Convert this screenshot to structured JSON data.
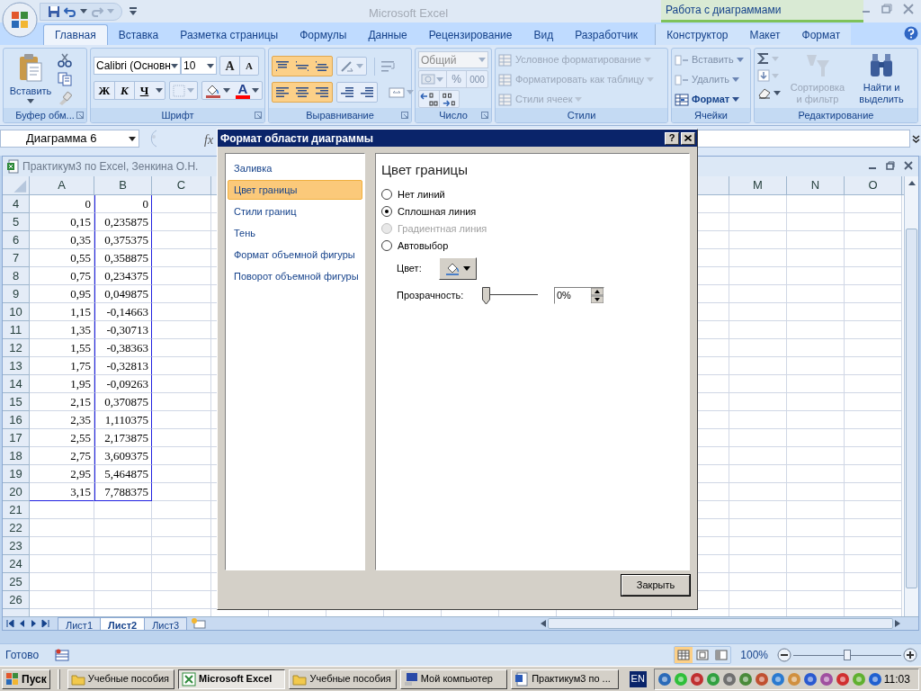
{
  "title_bar": {
    "app_title": "Microsoft Excel",
    "context_group": "Работа с диаграммами"
  },
  "ribbon_tabs": [
    {
      "label": "Главная",
      "selected": true,
      "kind": "tab"
    },
    {
      "label": "Вставка",
      "selected": false,
      "kind": "tab"
    },
    {
      "label": "Разметка страницы",
      "selected": false,
      "kind": "tab"
    },
    {
      "label": "Формулы",
      "selected": false,
      "kind": "tab"
    },
    {
      "label": "Данные",
      "selected": false,
      "kind": "tab"
    },
    {
      "label": "Рецензирование",
      "selected": false,
      "kind": "tab"
    },
    {
      "label": "Вид",
      "selected": false,
      "kind": "tab"
    },
    {
      "label": "Разработчик",
      "selected": false,
      "kind": "tab"
    },
    {
      "label": "Конструктор",
      "selected": false,
      "kind": "context"
    },
    {
      "label": "Макет",
      "selected": false,
      "kind": "context"
    },
    {
      "label": "Формат",
      "selected": false,
      "kind": "context"
    }
  ],
  "ribbon": {
    "clipboard": {
      "label": "Буфер обм...",
      "paste": "Вставить"
    },
    "font": {
      "label": "Шрифт",
      "font_name": "Calibri (Основн",
      "font_size": "10",
      "grow": "A",
      "shrink": "A",
      "bold": "Ж",
      "italic": "К",
      "underline": "Ч",
      "font_color": "A"
    },
    "alignment": {
      "label": "Выравнивание"
    },
    "number": {
      "label": "Число",
      "format": "Общий",
      "percent": "%",
      "thousands": "000"
    },
    "styles": {
      "label": "Стили",
      "items": [
        {
          "label": "Условное форматирование",
          "disabled": true
        },
        {
          "label": "Форматировать как таблицу",
          "disabled": true
        },
        {
          "label": "Стили ячеек",
          "disabled": true
        }
      ]
    },
    "cells": {
      "label": "Ячейки",
      "items": [
        {
          "label": "Вставить",
          "disabled": true
        },
        {
          "label": "Удалить",
          "disabled": true
        },
        {
          "label": "Формат",
          "disabled": false
        }
      ]
    },
    "editing": {
      "label": "Редактирование",
      "sort": {
        "lines": [
          "Сортировка",
          "и фильтр"
        ],
        "disabled": true
      },
      "find": {
        "lines": [
          "Найти и",
          "выделить"
        ],
        "disabled": false
      }
    }
  },
  "formula_bar": {
    "name_box": "Диаграмма 6",
    "function_label": "fx"
  },
  "workbook": {
    "title": "Практикум3 по Excel, Зенкина О.Н."
  },
  "sheet": {
    "columns": [
      "A",
      "B",
      "C",
      "M",
      "N",
      "O"
    ],
    "rows": [
      {
        "number": "4",
        "a": "0",
        "b": "0"
      },
      {
        "number": "5",
        "a": "0,15",
        "b": "0,235875"
      },
      {
        "number": "6",
        "a": "0,35",
        "b": "0,375375"
      },
      {
        "number": "7",
        "a": "0,55",
        "b": "0,358875"
      },
      {
        "number": "8",
        "a": "0,75",
        "b": "0,234375"
      },
      {
        "number": "9",
        "a": "0,95",
        "b": "0,049875"
      },
      {
        "number": "10",
        "a": "1,15",
        "b": "-0,14663"
      },
      {
        "number": "11",
        "a": "1,35",
        "b": "-0,30713"
      },
      {
        "number": "12",
        "a": "1,55",
        "b": "-0,38363"
      },
      {
        "number": "13",
        "a": "1,75",
        "b": "-0,32813"
      },
      {
        "number": "14",
        "a": "1,95",
        "b": "-0,09263"
      },
      {
        "number": "15",
        "a": "2,15",
        "b": "0,370875"
      },
      {
        "number": "16",
        "a": "2,35",
        "b": "1,110375"
      },
      {
        "number": "17",
        "a": "2,55",
        "b": "2,173875"
      },
      {
        "number": "18",
        "a": "2,75",
        "b": "3,609375"
      },
      {
        "number": "19",
        "a": "2,95",
        "b": "5,464875"
      },
      {
        "number": "20",
        "a": "3,15",
        "b": "7,788375"
      },
      {
        "number": "21"
      },
      {
        "number": "22"
      },
      {
        "number": "23"
      },
      {
        "number": "24"
      },
      {
        "number": "25"
      },
      {
        "number": "26"
      }
    ],
    "tabs": [
      {
        "label": "Лист1",
        "selected": false
      },
      {
        "label": "Лист2",
        "selected": true
      },
      {
        "label": "Лист3",
        "selected": false
      }
    ]
  },
  "dialog": {
    "title": "Формат области диаграммы",
    "help": "?",
    "categories": [
      {
        "label": "Заливка",
        "selected": false
      },
      {
        "label": "Цвет границы",
        "selected": true
      },
      {
        "label": "Стили границ",
        "selected": false
      },
      {
        "label": "Тень",
        "selected": false
      },
      {
        "label": "Формат объемной фигуры",
        "selected": false
      },
      {
        "label": "Поворот объемной фигуры",
        "selected": false
      }
    ],
    "heading": "Цвет границы",
    "options": [
      {
        "label": "Нет линий",
        "selected": false,
        "disabled": false
      },
      {
        "label": "Сплошная линия",
        "selected": true,
        "disabled": false
      },
      {
        "label": "Градиентная линия",
        "selected": false,
        "disabled": true
      },
      {
        "label": "Автовыбор",
        "selected": false,
        "disabled": false
      }
    ],
    "color_label": "Цвет:",
    "transparency_label": "Прозрачность:",
    "transparency": {
      "level": 0,
      "value": "0%"
    },
    "close_button": "Закрыть"
  },
  "status_bar": {
    "text": "Готово",
    "views": [
      {
        "kind": "normal",
        "selected": true
      },
      {
        "kind": "page_layout",
        "selected": false
      },
      {
        "kind": "page_break",
        "selected": false
      }
    ],
    "zoom": "100%",
    "zoom_slider": {
      "level": 0.5
    }
  },
  "taskbar": {
    "start": "Пуск",
    "buttons": [
      {
        "label": "Учебные пособия",
        "kind": "folder",
        "selected": false
      },
      {
        "label": "Microsoft Excel",
        "kind": "excel",
        "selected": true
      },
      {
        "label": "Учебные пособия",
        "kind": "folder",
        "selected": false
      },
      {
        "label": "Мой компьютер",
        "kind": "computer",
        "selected": false
      },
      {
        "label": "Практикум3 по ...",
        "kind": "word",
        "selected": false
      }
    ],
    "language": "EN",
    "clock": "11:03"
  }
}
